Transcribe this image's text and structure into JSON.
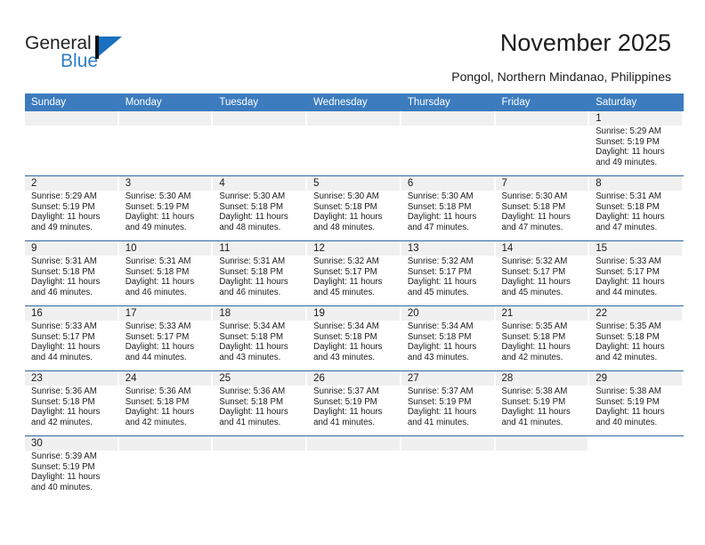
{
  "brand": {
    "line1": "General",
    "line2": "Blue",
    "mark": "triangle-logo"
  },
  "header": {
    "title": "November 2025",
    "subtitle": "Pongol, Northern Mindanao, Philippines"
  },
  "colors": {
    "header_blue": "#3c7cbe",
    "row_rule_blue": "#31679e",
    "daynum_strip": "#f0f0f0",
    "brand_blue": "#2f7fc4",
    "text": "#1c1c1c"
  },
  "weekdays": [
    "Sunday",
    "Monday",
    "Tuesday",
    "Wednesday",
    "Thursday",
    "Friday",
    "Saturday"
  ],
  "labels": {
    "sunrise_prefix": "Sunrise:",
    "sunset_prefix": "Sunset:",
    "daylight_prefix": "Daylight:"
  },
  "weeks": [
    [
      {
        "day": "",
        "line1": "",
        "line2": "",
        "line3": "",
        "line4": "",
        "empty": true
      },
      {
        "day": "",
        "line1": "",
        "line2": "",
        "line3": "",
        "line4": "",
        "empty": true
      },
      {
        "day": "",
        "line1": "",
        "line2": "",
        "line3": "",
        "line4": "",
        "empty": true
      },
      {
        "day": "",
        "line1": "",
        "line2": "",
        "line3": "",
        "line4": "",
        "empty": true
      },
      {
        "day": "",
        "line1": "",
        "line2": "",
        "line3": "",
        "line4": "",
        "empty": true
      },
      {
        "day": "",
        "line1": "",
        "line2": "",
        "line3": "",
        "line4": "",
        "empty": true
      },
      {
        "day": "1",
        "line1": "Sunrise: 5:29 AM",
        "line2": "Sunset: 5:19 PM",
        "line3": "Daylight: 11 hours",
        "line4": "and 49 minutes."
      }
    ],
    [
      {
        "day": "2",
        "line1": "Sunrise: 5:29 AM",
        "line2": "Sunset: 5:19 PM",
        "line3": "Daylight: 11 hours",
        "line4": "and 49 minutes."
      },
      {
        "day": "3",
        "line1": "Sunrise: 5:30 AM",
        "line2": "Sunset: 5:19 PM",
        "line3": "Daylight: 11 hours",
        "line4": "and 49 minutes."
      },
      {
        "day": "4",
        "line1": "Sunrise: 5:30 AM",
        "line2": "Sunset: 5:18 PM",
        "line3": "Daylight: 11 hours",
        "line4": "and 48 minutes."
      },
      {
        "day": "5",
        "line1": "Sunrise: 5:30 AM",
        "line2": "Sunset: 5:18 PM",
        "line3": "Daylight: 11 hours",
        "line4": "and 48 minutes."
      },
      {
        "day": "6",
        "line1": "Sunrise: 5:30 AM",
        "line2": "Sunset: 5:18 PM",
        "line3": "Daylight: 11 hours",
        "line4": "and 47 minutes."
      },
      {
        "day": "7",
        "line1": "Sunrise: 5:30 AM",
        "line2": "Sunset: 5:18 PM",
        "line3": "Daylight: 11 hours",
        "line4": "and 47 minutes."
      },
      {
        "day": "8",
        "line1": "Sunrise: 5:31 AM",
        "line2": "Sunset: 5:18 PM",
        "line3": "Daylight: 11 hours",
        "line4": "and 47 minutes."
      }
    ],
    [
      {
        "day": "9",
        "line1": "Sunrise: 5:31 AM",
        "line2": "Sunset: 5:18 PM",
        "line3": "Daylight: 11 hours",
        "line4": "and 46 minutes."
      },
      {
        "day": "10",
        "line1": "Sunrise: 5:31 AM",
        "line2": "Sunset: 5:18 PM",
        "line3": "Daylight: 11 hours",
        "line4": "and 46 minutes."
      },
      {
        "day": "11",
        "line1": "Sunrise: 5:31 AM",
        "line2": "Sunset: 5:18 PM",
        "line3": "Daylight: 11 hours",
        "line4": "and 46 minutes."
      },
      {
        "day": "12",
        "line1": "Sunrise: 5:32 AM",
        "line2": "Sunset: 5:17 PM",
        "line3": "Daylight: 11 hours",
        "line4": "and 45 minutes."
      },
      {
        "day": "13",
        "line1": "Sunrise: 5:32 AM",
        "line2": "Sunset: 5:17 PM",
        "line3": "Daylight: 11 hours",
        "line4": "and 45 minutes."
      },
      {
        "day": "14",
        "line1": "Sunrise: 5:32 AM",
        "line2": "Sunset: 5:17 PM",
        "line3": "Daylight: 11 hours",
        "line4": "and 45 minutes."
      },
      {
        "day": "15",
        "line1": "Sunrise: 5:33 AM",
        "line2": "Sunset: 5:17 PM",
        "line3": "Daylight: 11 hours",
        "line4": "and 44 minutes."
      }
    ],
    [
      {
        "day": "16",
        "line1": "Sunrise: 5:33 AM",
        "line2": "Sunset: 5:17 PM",
        "line3": "Daylight: 11 hours",
        "line4": "and 44 minutes."
      },
      {
        "day": "17",
        "line1": "Sunrise: 5:33 AM",
        "line2": "Sunset: 5:17 PM",
        "line3": "Daylight: 11 hours",
        "line4": "and 44 minutes."
      },
      {
        "day": "18",
        "line1": "Sunrise: 5:34 AM",
        "line2": "Sunset: 5:18 PM",
        "line3": "Daylight: 11 hours",
        "line4": "and 43 minutes."
      },
      {
        "day": "19",
        "line1": "Sunrise: 5:34 AM",
        "line2": "Sunset: 5:18 PM",
        "line3": "Daylight: 11 hours",
        "line4": "and 43 minutes."
      },
      {
        "day": "20",
        "line1": "Sunrise: 5:34 AM",
        "line2": "Sunset: 5:18 PM",
        "line3": "Daylight: 11 hours",
        "line4": "and 43 minutes."
      },
      {
        "day": "21",
        "line1": "Sunrise: 5:35 AM",
        "line2": "Sunset: 5:18 PM",
        "line3": "Daylight: 11 hours",
        "line4": "and 42 minutes."
      },
      {
        "day": "22",
        "line1": "Sunrise: 5:35 AM",
        "line2": "Sunset: 5:18 PM",
        "line3": "Daylight: 11 hours",
        "line4": "and 42 minutes."
      }
    ],
    [
      {
        "day": "23",
        "line1": "Sunrise: 5:36 AM",
        "line2": "Sunset: 5:18 PM",
        "line3": "Daylight: 11 hours",
        "line4": "and 42 minutes."
      },
      {
        "day": "24",
        "line1": "Sunrise: 5:36 AM",
        "line2": "Sunset: 5:18 PM",
        "line3": "Daylight: 11 hours",
        "line4": "and 42 minutes."
      },
      {
        "day": "25",
        "line1": "Sunrise: 5:36 AM",
        "line2": "Sunset: 5:18 PM",
        "line3": "Daylight: 11 hours",
        "line4": "and 41 minutes."
      },
      {
        "day": "26",
        "line1": "Sunrise: 5:37 AM",
        "line2": "Sunset: 5:19 PM",
        "line3": "Daylight: 11 hours",
        "line4": "and 41 minutes."
      },
      {
        "day": "27",
        "line1": "Sunrise: 5:37 AM",
        "line2": "Sunset: 5:19 PM",
        "line3": "Daylight: 11 hours",
        "line4": "and 41 minutes."
      },
      {
        "day": "28",
        "line1": "Sunrise: 5:38 AM",
        "line2": "Sunset: 5:19 PM",
        "line3": "Daylight: 11 hours",
        "line4": "and 41 minutes."
      },
      {
        "day": "29",
        "line1": "Sunrise: 5:38 AM",
        "line2": "Sunset: 5:19 PM",
        "line3": "Daylight: 11 hours",
        "line4": "and 40 minutes."
      }
    ],
    [
      {
        "day": "30",
        "line1": "Sunrise: 5:39 AM",
        "line2": "Sunset: 5:19 PM",
        "line3": "Daylight: 11 hours",
        "line4": "and 40 minutes."
      },
      {
        "day": "",
        "line1": "",
        "line2": "",
        "line3": "",
        "line4": "",
        "empty": true
      },
      {
        "day": "",
        "line1": "",
        "line2": "",
        "line3": "",
        "line4": "",
        "empty": true
      },
      {
        "day": "",
        "line1": "",
        "line2": "",
        "line3": "",
        "line4": "",
        "empty": true
      },
      {
        "day": "",
        "line1": "",
        "line2": "",
        "line3": "",
        "line4": "",
        "empty": true
      },
      {
        "day": "",
        "line1": "",
        "line2": "",
        "line3": "",
        "line4": "",
        "empty": true
      },
      {
        "day": "",
        "line1": "",
        "line2": "",
        "line3": "",
        "line4": "",
        "empty": true,
        "nostrip": true
      }
    ]
  ]
}
